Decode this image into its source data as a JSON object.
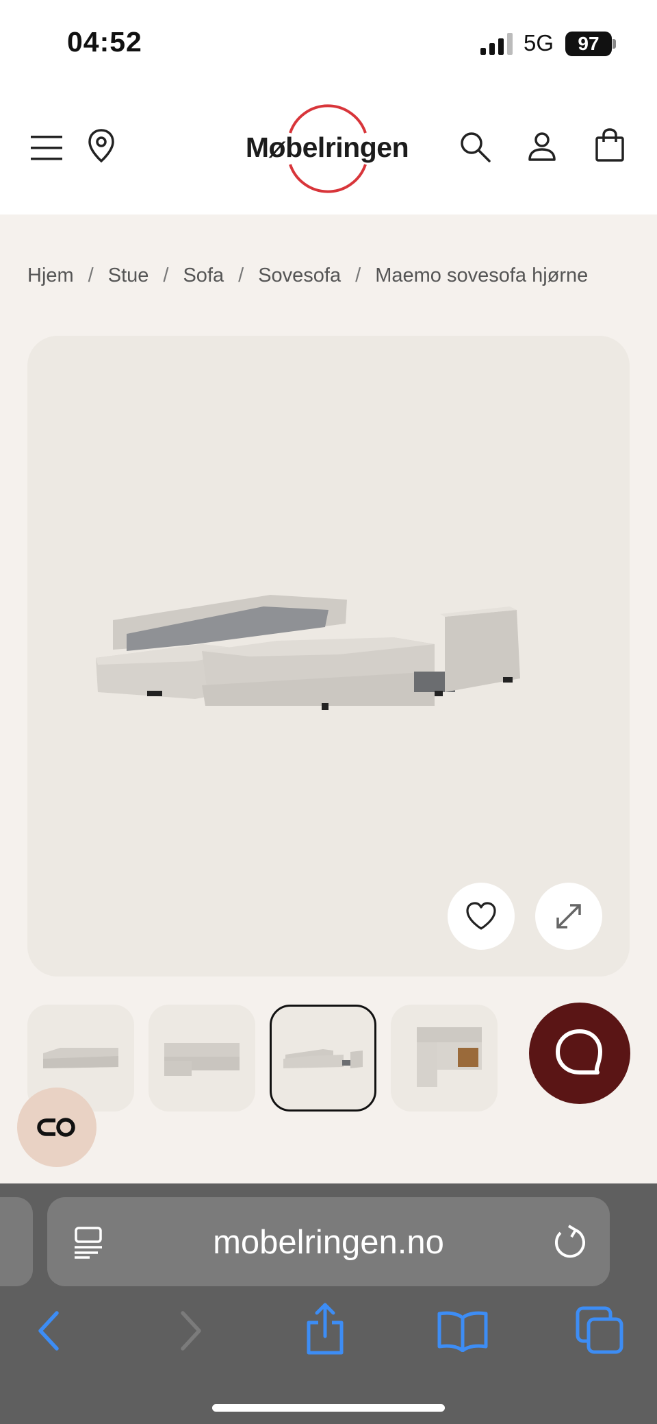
{
  "status_bar": {
    "time": "04:52",
    "network": "5G",
    "battery": "97"
  },
  "header": {
    "logo_text": "Møbelringen"
  },
  "breadcrumb": [
    "Hjem",
    "Stue",
    "Sofa",
    "Sovesofa",
    "Maemo sovesofa hjørne"
  ],
  "breadcrumb_separator": "/",
  "product_gallery": {
    "active_thumbnail_index": 2,
    "thumbnail_count": 4
  },
  "browser": {
    "url": "mobelringen.no"
  },
  "colors": {
    "brand_red": "#d8353a",
    "chat_bg": "#5a1515",
    "browser_blue": "#3d8df5"
  }
}
